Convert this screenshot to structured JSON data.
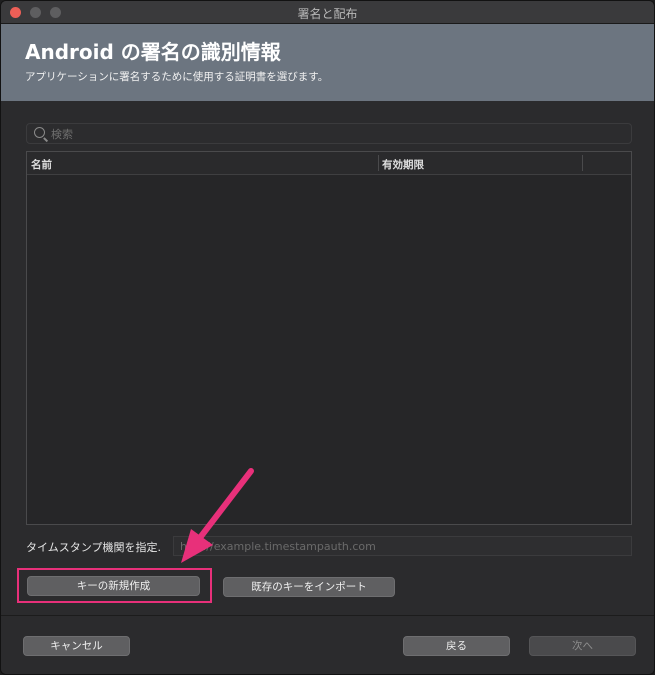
{
  "window": {
    "title": "署名と配布"
  },
  "header": {
    "title": "Android の署名の識別情報",
    "subtitle": "アプリケーションに署名するために使用する証明書を選びます。"
  },
  "search": {
    "placeholder": "検索",
    "value": ""
  },
  "table": {
    "columns": [
      "名前",
      "有効期限"
    ],
    "rows": []
  },
  "timestamp": {
    "label": "タイムスタンプ機関を指定.",
    "placeholder": "http://example.timestampauth.com"
  },
  "actions": {
    "new_key": "キーの新規作成",
    "import_key": "既存のキーをインポート"
  },
  "footer": {
    "cancel": "キャンセル",
    "back": "戻る",
    "next": "次へ"
  },
  "annotation": {
    "highlight_color": "#e8307a"
  }
}
